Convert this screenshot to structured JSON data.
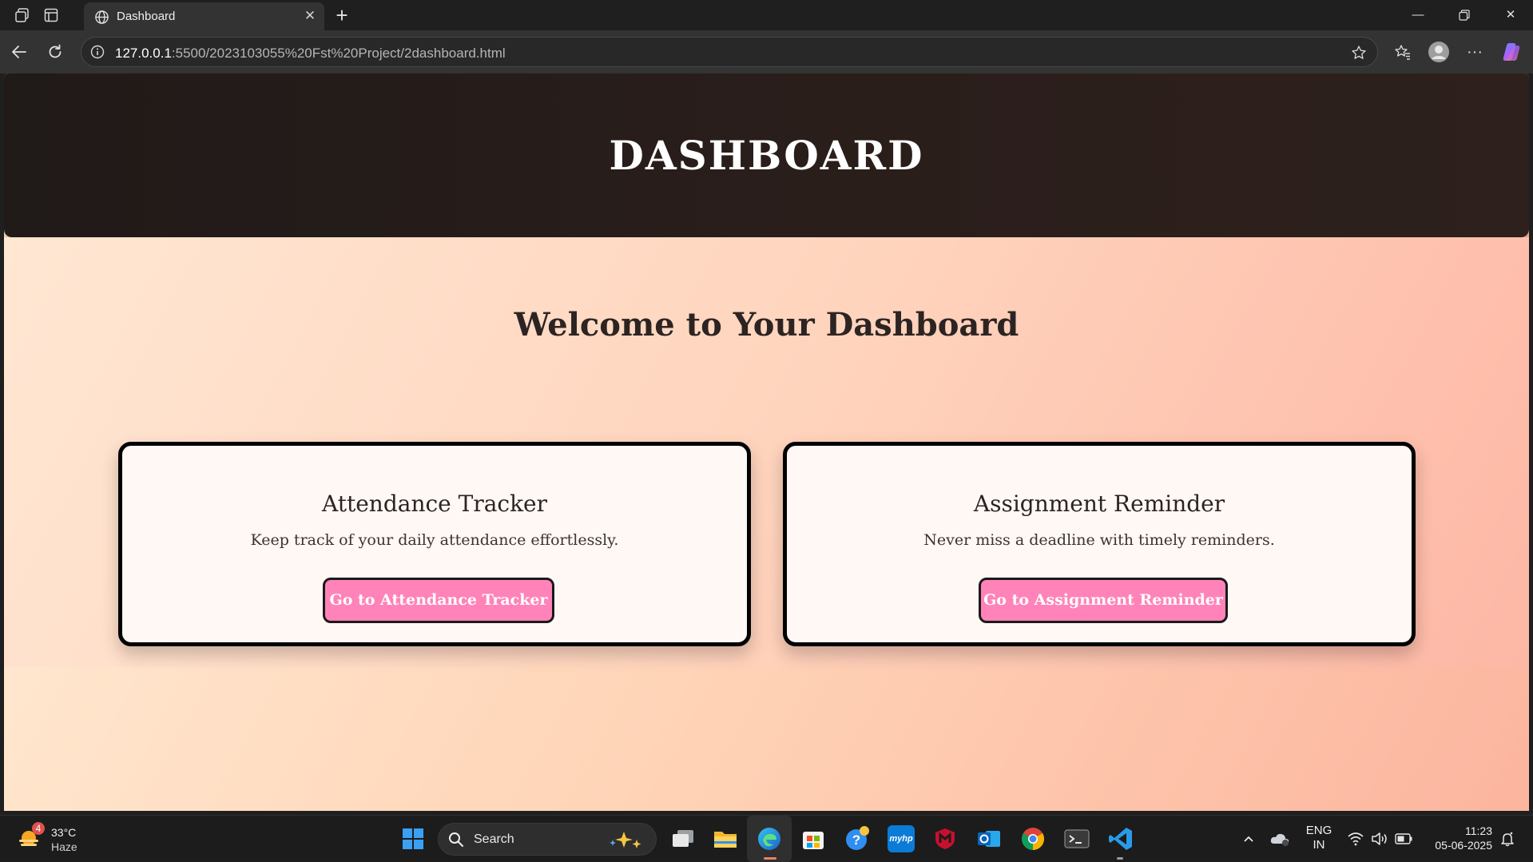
{
  "browser": {
    "tab_title": "Dashboard",
    "address_host": "127.0.0.1",
    "address_path": ":5500/2023103055%20Fst%20Project/2dashboard.html"
  },
  "page": {
    "header_title": "DASHBOARD",
    "welcome": "Welcome to Your Dashboard",
    "cards": [
      {
        "title": "Attendance Tracker",
        "description": "Keep track of your daily attendance effortlessly.",
        "button": "Go to Attendance Tracker"
      },
      {
        "title": "Assignment Reminder",
        "description": "Never miss a deadline with timely reminders.",
        "button": "Go to Assignment Reminder"
      }
    ],
    "colors": {
      "header_bg": "#231b19",
      "button_bg": "#ff83b8",
      "card_bg": "#fff8f5"
    }
  },
  "taskbar": {
    "weather_temp": "33°C",
    "weather_desc": "Haze",
    "weather_badge": "4",
    "search_placeholder": "Search",
    "lang_top": "ENG",
    "lang_bottom": "IN",
    "time": "11:23",
    "date": "05-06-2025",
    "icons": [
      "windows-start-icon",
      "task-view-icon",
      "file-explorer-icon",
      "edge-icon",
      "store-icon",
      "help-icon",
      "myhp-icon",
      "mcafee-icon",
      "outlook-icon",
      "chrome-icon",
      "terminal-icon",
      "vscode-icon"
    ]
  }
}
